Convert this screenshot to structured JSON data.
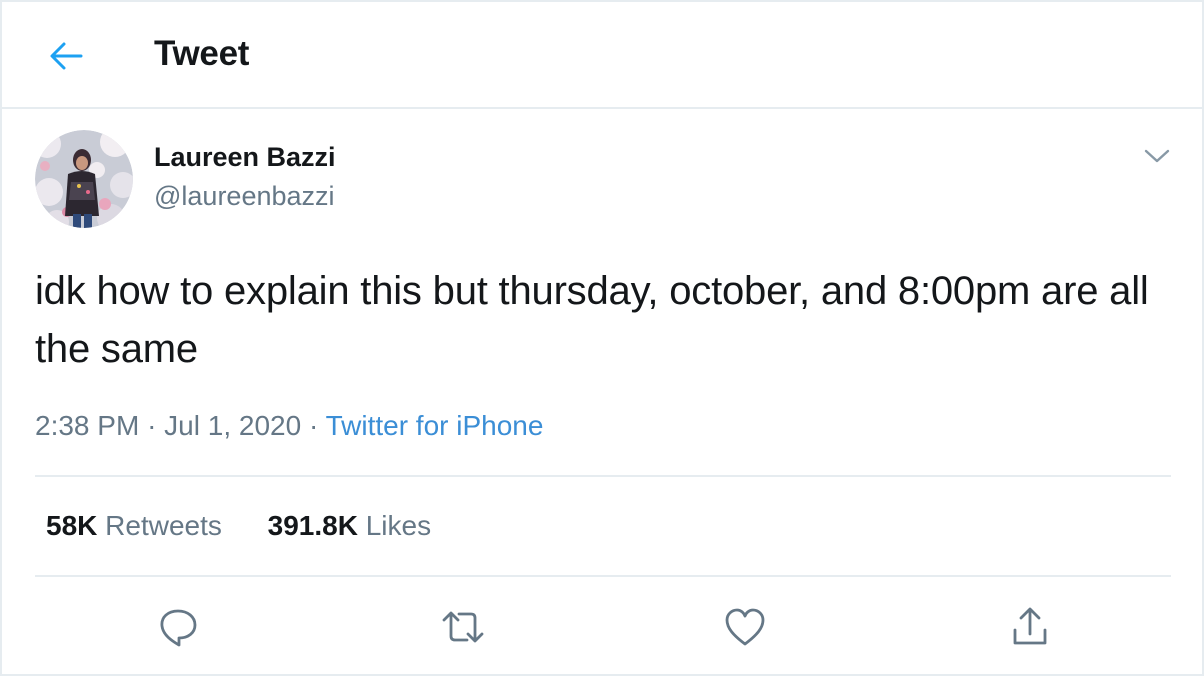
{
  "header": {
    "back_icon": "arrow-left-icon",
    "title": "Tweet"
  },
  "author": {
    "name": "Laureen Bazzi",
    "handle": "@laureenbazzi",
    "avatar_icon": "profile-photo"
  },
  "menu": {
    "icon": "chevron-down-icon"
  },
  "tweet": {
    "text": "idk how to explain this but thursday, october, and 8:00pm are all the same",
    "time": "2:38 PM",
    "separator": "·",
    "date": "Jul 1, 2020",
    "source": "Twitter for iPhone"
  },
  "stats": {
    "retweets_count": "58K",
    "retweets_label": "Retweets",
    "likes_count": "391.8K",
    "likes_label": "Likes"
  },
  "actions": [
    {
      "icon": "reply-icon"
    },
    {
      "icon": "retweet-icon"
    },
    {
      "icon": "like-icon"
    },
    {
      "icon": "share-icon"
    }
  ],
  "colors": {
    "accent": "#1da1f2",
    "link": "#3b8ed6",
    "text": "#14171a",
    "secondary_text": "#657786",
    "border": "#e6ecf0"
  }
}
